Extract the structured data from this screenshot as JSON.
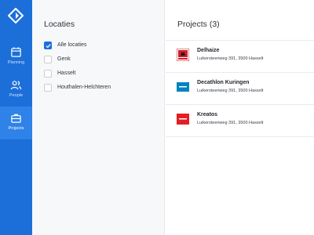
{
  "sidebar": {
    "nav": [
      {
        "label": "Planning",
        "icon": "calendar-icon"
      },
      {
        "label": "People",
        "icon": "people-icon"
      },
      {
        "label": "Projects",
        "icon": "briefcase-icon"
      }
    ],
    "logo_icon": "diamond-logo",
    "colors": {
      "background": "#1c6fd9",
      "active": "#2e82e8"
    }
  },
  "filters": {
    "title": "Locaties",
    "options": [
      {
        "label": "Alle locaties",
        "checked": true
      },
      {
        "label": "Genk",
        "checked": false
      },
      {
        "label": "Hasselt",
        "checked": false
      },
      {
        "label": "Houthalen-Helchteren",
        "checked": false
      }
    ]
  },
  "projects": {
    "title": "Projects (3)",
    "items": [
      {
        "name": "Delhaize",
        "address": "Luikersteenweg 391, 3500 Hasselt",
        "logo_color": "#d21f2b"
      },
      {
        "name": "Decathlon Kuringen",
        "address": "Luikersteenweg 391, 3500 Hasselt",
        "logo_color": "#0082c3"
      },
      {
        "name": "Kreatos",
        "address": "Luikersteenweg 391, 3500 Hasselt",
        "logo_color": "#e31e24"
      }
    ]
  }
}
